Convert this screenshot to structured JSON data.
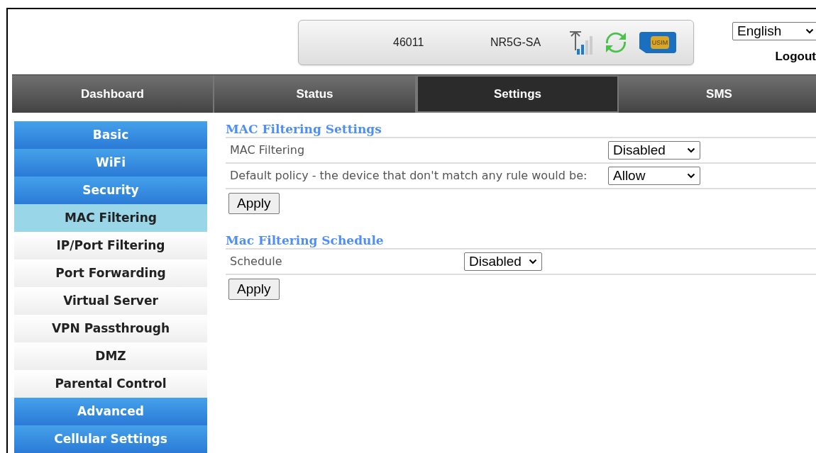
{
  "header": {
    "status": {
      "operator": "46011",
      "network": "NR5G-SA",
      "sim_label": "USIM"
    },
    "language": {
      "value": "English"
    },
    "logout": "Logout"
  },
  "nav_tabs": [
    {
      "label": "Dashboard",
      "selected": false
    },
    {
      "label": "Status",
      "selected": false
    },
    {
      "label": "Settings",
      "selected": true
    },
    {
      "label": "SMS",
      "selected": false
    }
  ],
  "sidebar": {
    "items": [
      {
        "kind": "section",
        "label": "Basic",
        "selected": false
      },
      {
        "kind": "section",
        "label": "WiFi",
        "selected": false
      },
      {
        "kind": "section",
        "label": "Security",
        "selected": false
      },
      {
        "kind": "item",
        "label": "MAC Filtering",
        "selected": true
      },
      {
        "kind": "item",
        "label": "IP/Port Filtering",
        "selected": false
      },
      {
        "kind": "item",
        "label": "Port Forwarding",
        "selected": false
      },
      {
        "kind": "item",
        "label": "Virtual Server",
        "selected": false
      },
      {
        "kind": "item",
        "label": "VPN Passthrough",
        "selected": false
      },
      {
        "kind": "item",
        "label": "DMZ",
        "selected": false
      },
      {
        "kind": "item",
        "label": "Parental Control",
        "selected": false
      },
      {
        "kind": "section",
        "label": "Advanced",
        "selected": false
      },
      {
        "kind": "section",
        "label": "Cellular Settings",
        "selected": false
      }
    ]
  },
  "sections": [
    {
      "title": "MAC Filtering Settings",
      "rows": [
        {
          "label": "MAC Filtering",
          "value": "Disabled"
        },
        {
          "label": "Default policy - the device that don't match any rule would be:",
          "value": "Allow"
        }
      ],
      "button": "Apply"
    },
    {
      "title": "Mac Filtering Schedule",
      "rows": [
        {
          "label": "Schedule",
          "value": "Disabled"
        }
      ],
      "button": "Apply"
    }
  ]
}
